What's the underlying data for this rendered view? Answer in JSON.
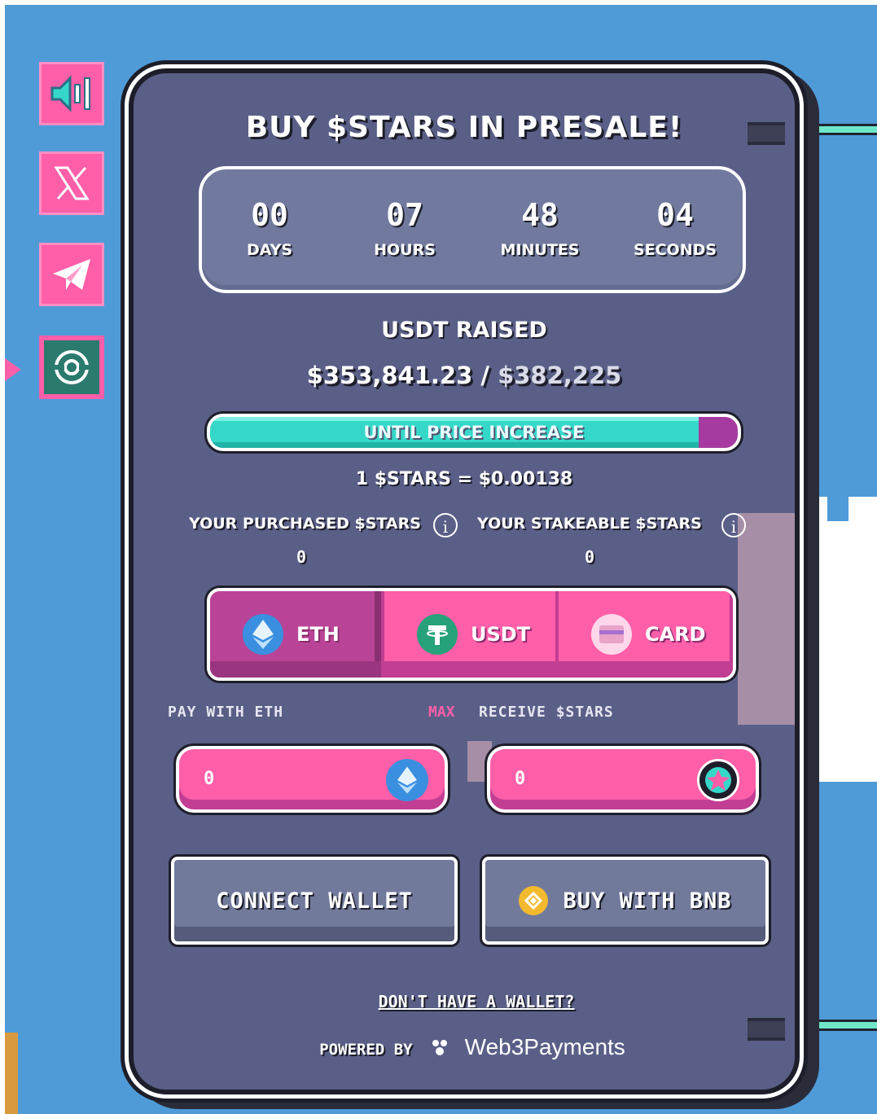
{
  "social": {
    "items": [
      {
        "name": "sound",
        "icon": "speaker-icon"
      },
      {
        "name": "x",
        "icon": "x-logo-icon"
      },
      {
        "name": "telegram",
        "icon": "telegram-icon"
      },
      {
        "name": "coinmarketcap",
        "icon": "coinmarketcap-icon"
      }
    ]
  },
  "presale": {
    "title": "BUY $STARS IN PRESALE!",
    "countdown": [
      {
        "value": "00",
        "label": "DAYS"
      },
      {
        "value": "07",
        "label": "HOURS"
      },
      {
        "value": "48",
        "label": "MINUTES"
      },
      {
        "value": "04",
        "label": "SECONDS"
      }
    ],
    "raised_label": "USDT RAISED",
    "raised_amount": "$353,841.23",
    "raised_separator": " / ",
    "raised_goal": "$382,225",
    "progress_label": "UNTIL PRICE INCREASE",
    "progress_fraction": 0.926,
    "price_line": "1 $STARS = $0.00138",
    "purchased_label": "YOUR PURCHASED $STARS",
    "purchased_value": "0",
    "stakeable_label": "YOUR STAKEABLE $STARS",
    "stakeable_value": "0",
    "info_glyph": "i",
    "tabs": [
      {
        "label": "ETH",
        "icon": "ethereum-icon",
        "active": true
      },
      {
        "label": "USDT",
        "icon": "tether-icon",
        "active": false
      },
      {
        "label": "CARD",
        "icon": "card-icon",
        "active": false
      }
    ],
    "pay_label": "PAY WITH ETH",
    "max_label": "MAX",
    "receive_label": "RECEIVE $STARS",
    "pay_value": "0",
    "receive_value": "0",
    "connect_label": "CONNECT WALLET",
    "bnb_label": "BUY WITH BNB",
    "no_wallet_label": "DON'T HAVE A WALLET?",
    "powered_by": "POWERED BY",
    "powered_brand": "Web3Payments"
  },
  "colors": {
    "background": "#4f9bd8",
    "card": "#5a5f87",
    "accent_pink": "#ff5ea8",
    "progress_teal": "#35d8c8"
  }
}
